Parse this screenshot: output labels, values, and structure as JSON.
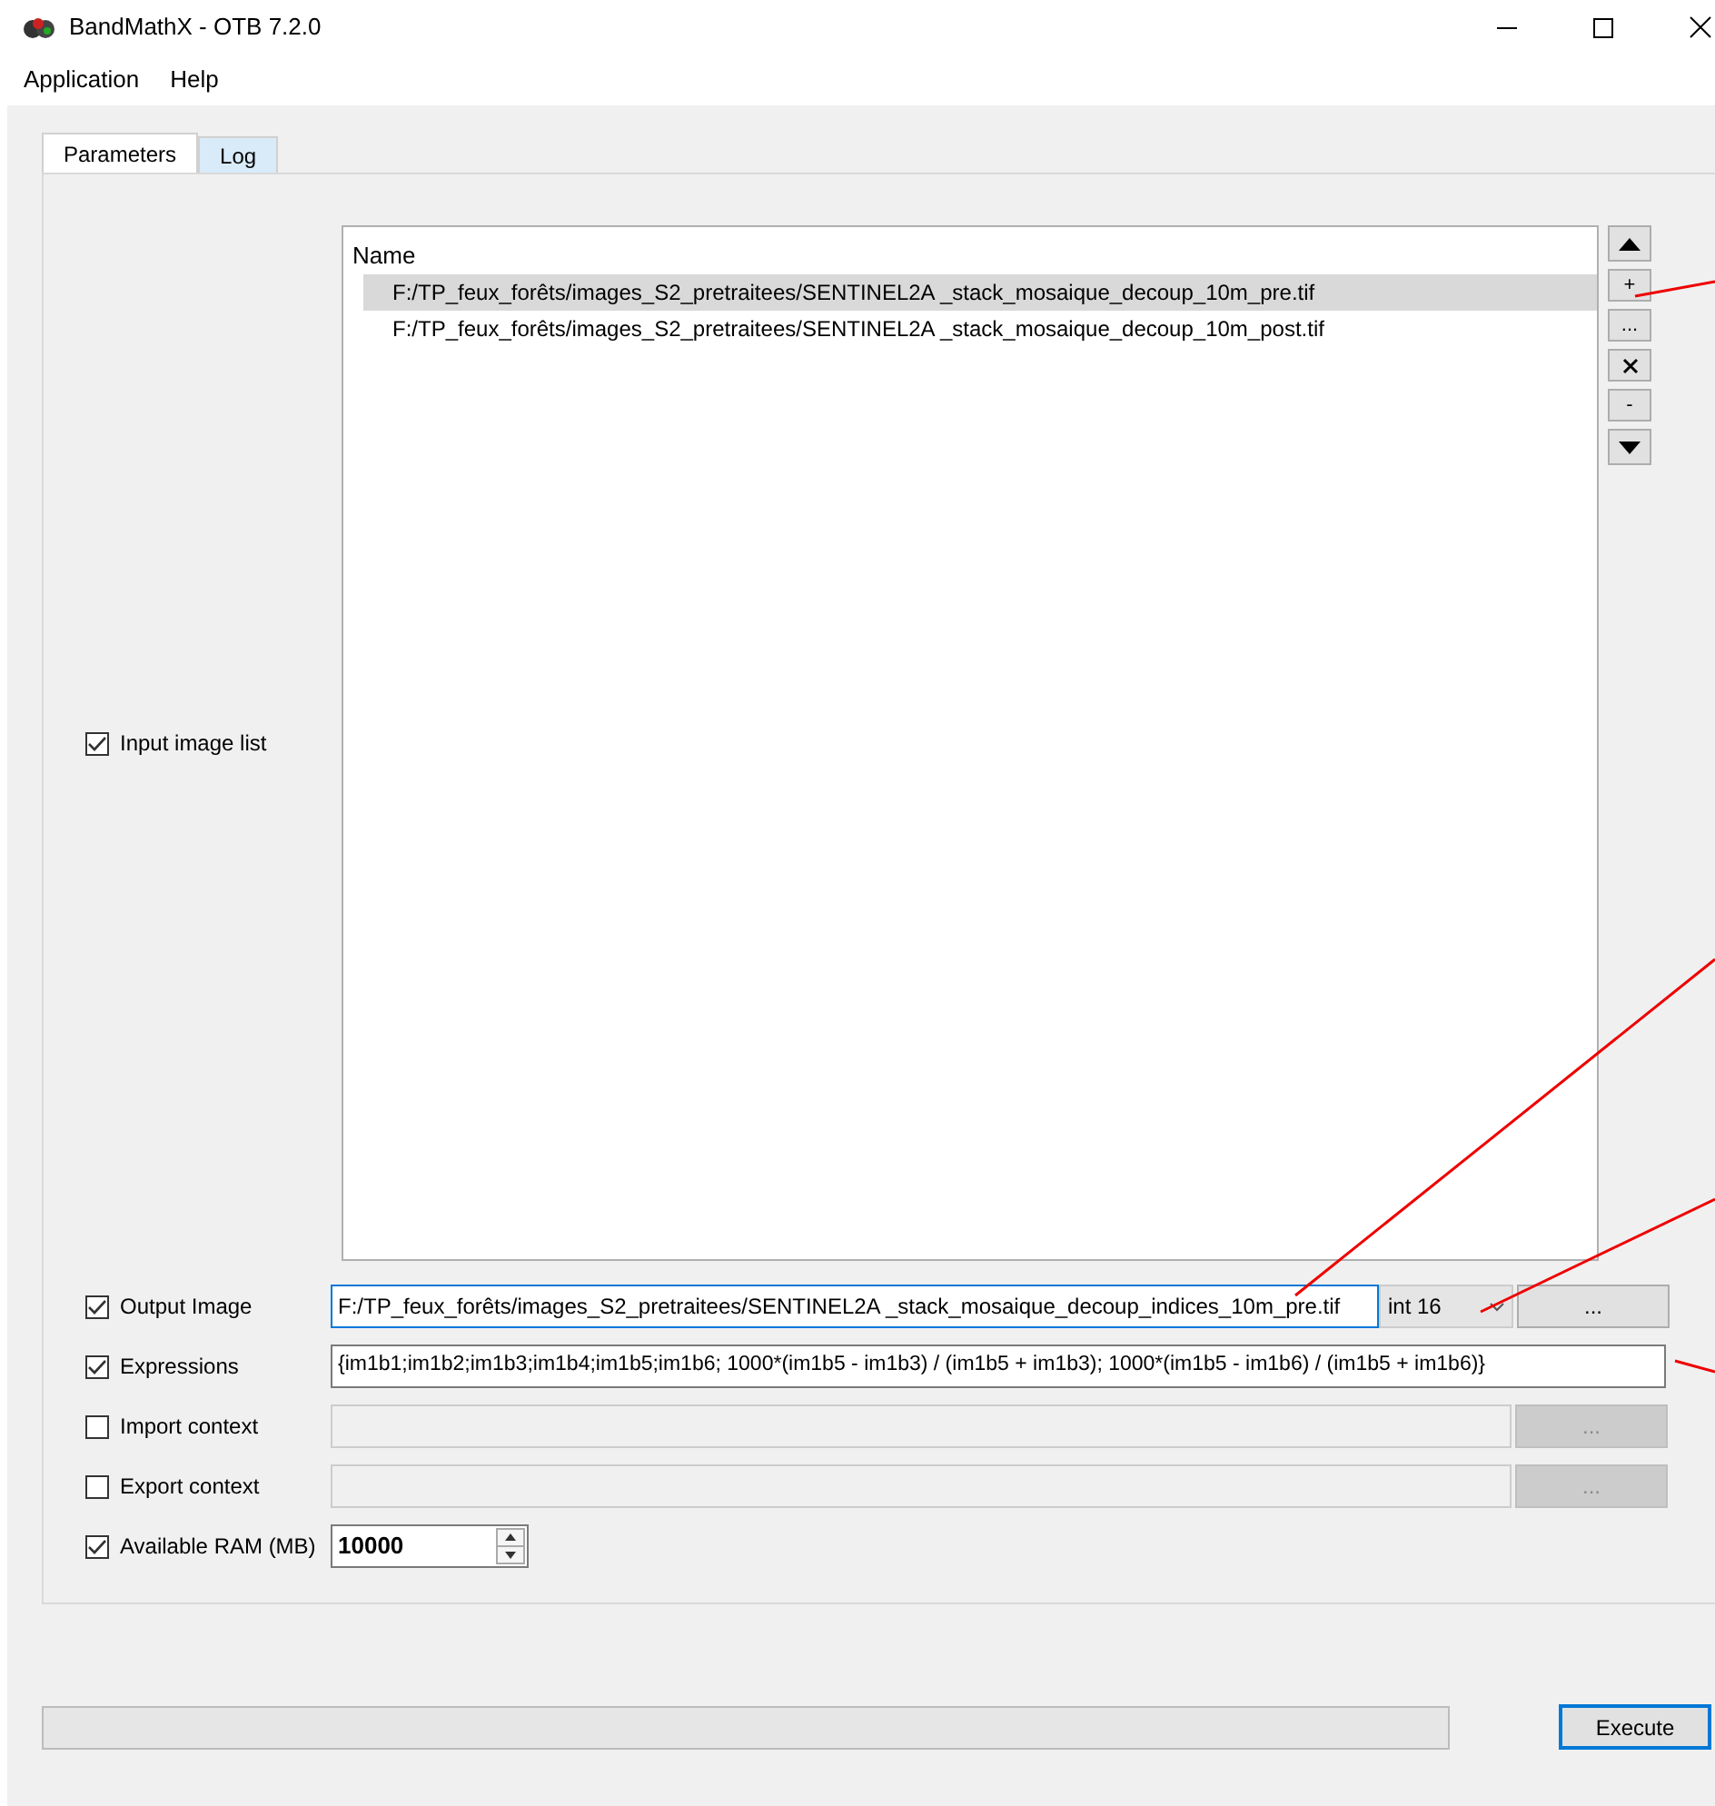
{
  "window": {
    "title": "BandMathX - OTB 7.2.0"
  },
  "menu": [
    "Application",
    "Help"
  ],
  "tabs": [
    {
      "label": "Parameters",
      "selected": true
    },
    {
      "label": "Log",
      "selected": false
    }
  ],
  "input_image_list": {
    "label": "Input image list",
    "checked": true,
    "header": "Name",
    "items": [
      {
        "path": "F:/TP_feux_forêts/images_S2_pretraitees/SENTINEL2A _stack_mosaique_decoup_10m_pre.tif",
        "selected": true
      },
      {
        "path": "F:/TP_feux_forêts/images_S2_pretraitees/SENTINEL2A _stack_mosaique_decoup_10m_post.tif",
        "selected": false
      }
    ],
    "buttons": [
      {
        "kind": "up"
      },
      {
        "kind": "text",
        "label": "+"
      },
      {
        "kind": "text",
        "label": "..."
      },
      {
        "kind": "clear"
      },
      {
        "kind": "text",
        "label": "-"
      },
      {
        "kind": "down"
      }
    ]
  },
  "parameters": [
    {
      "kind": "file",
      "label": "Output Image",
      "checked": true,
      "value": "F:/TP_feux_forêts/images_S2_pretraitees/SENTINEL2A _stack_mosaique_decoup_indices_10m_pre.tif",
      "type": "int 16",
      "button": "...",
      "disabled": false
    },
    {
      "kind": "text",
      "label": "Expressions",
      "checked": true,
      "value": "{im1b1;im1b2;im1b3;im1b4;im1b5;im1b6; 1000*(im1b5 - im1b3) / (im1b5 + im1b3); 1000*(im1b5 - im1b6) / (im1b5 + im1b6)}",
      "disabled": false
    },
    {
      "kind": "file",
      "label": "Import context",
      "checked": false,
      "button": "...",
      "disabled": true
    },
    {
      "kind": "file",
      "label": "Export context",
      "checked": false,
      "button": "...",
      "disabled": true
    },
    {
      "kind": "spin",
      "label": "Available RAM (MB)",
      "checked": true,
      "value": "10000",
      "disabled": false
    }
  ],
  "progress": {
    "level": 0
  },
  "execute_button": "Execute"
}
